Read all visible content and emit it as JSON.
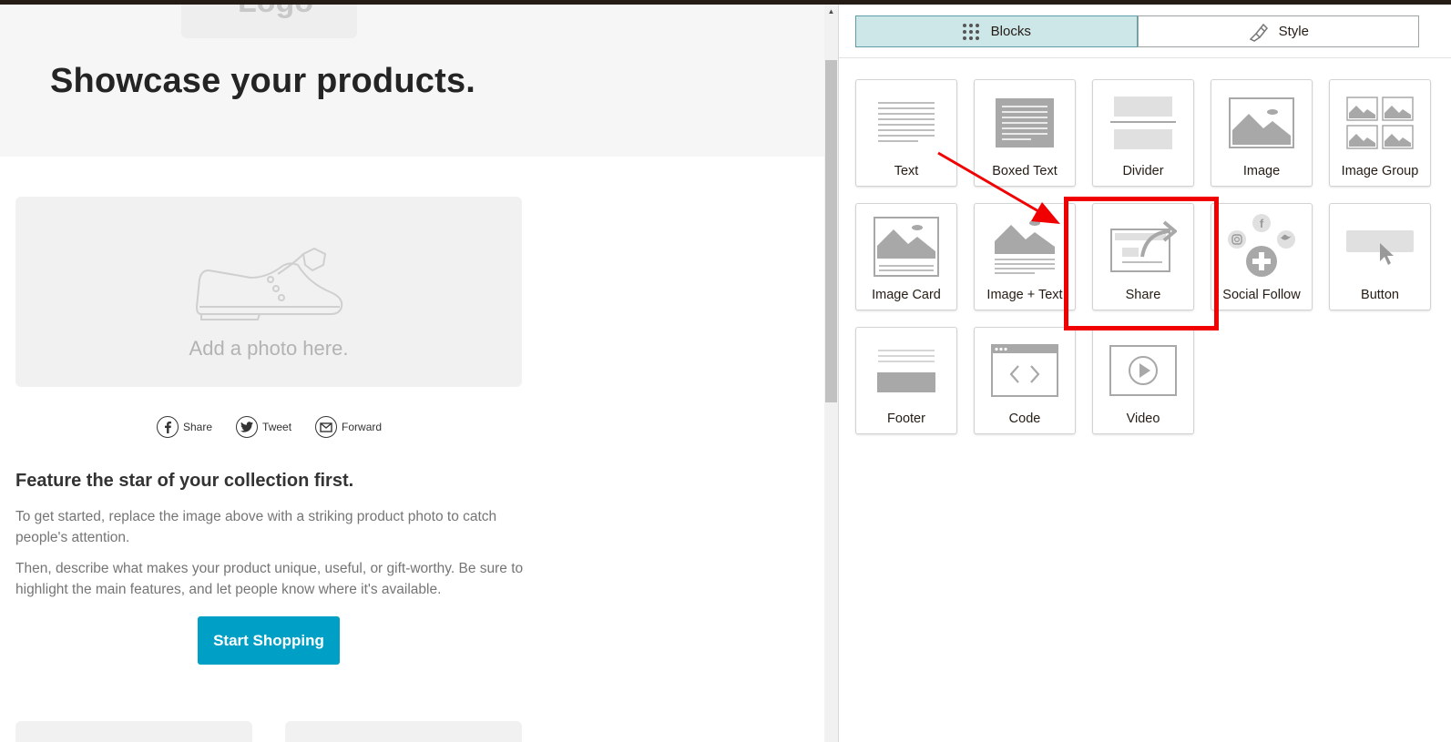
{
  "preview": {
    "logo_text": "Logo",
    "hero_title": "Showcase your products.",
    "photo_placeholder": "Add a photo here.",
    "share_buttons": [
      {
        "label": "Share",
        "icon": "facebook-icon"
      },
      {
        "label": "Tweet",
        "icon": "twitter-icon"
      },
      {
        "label": "Forward",
        "icon": "email-icon"
      }
    ],
    "feature_title": "Feature the star of your collection first.",
    "paragraph_1": "To get started, replace the image above with a striking product photo to catch people's attention.",
    "paragraph_2": "Then, describe what makes your product unique, useful, or gift-worthy. Be sure to highlight the main features, and let people know where it's available.",
    "cta_label": "Start Shopping",
    "cta_color": "#00a0c6"
  },
  "panel": {
    "tabs": [
      {
        "label": "Blocks",
        "icon": "grid-icon",
        "active": true
      },
      {
        "label": "Style",
        "icon": "paint-brush-icon",
        "active": false
      }
    ],
    "blocks": [
      {
        "label": "Text",
        "icon": "text-block-icon"
      },
      {
        "label": "Boxed Text",
        "icon": "boxed-text-block-icon"
      },
      {
        "label": "Divider",
        "icon": "divider-block-icon"
      },
      {
        "label": "Image",
        "icon": "image-block-icon"
      },
      {
        "label": "Image Group",
        "icon": "image-group-block-icon"
      },
      {
        "label": "Image Card",
        "icon": "image-card-block-icon"
      },
      {
        "label": "Image + Text",
        "icon": "image-text-block-icon"
      },
      {
        "label": "Share",
        "icon": "share-block-icon"
      },
      {
        "label": "Social Follow",
        "icon": "social-follow-block-icon"
      },
      {
        "label": "Button",
        "icon": "button-block-icon"
      },
      {
        "label": "Footer",
        "icon": "footer-block-icon"
      },
      {
        "label": "Code",
        "icon": "code-block-icon"
      },
      {
        "label": "Video",
        "icon": "video-block-icon"
      }
    ],
    "active_tab_color": "#cde6e8",
    "annotation_color": "#f00000"
  }
}
